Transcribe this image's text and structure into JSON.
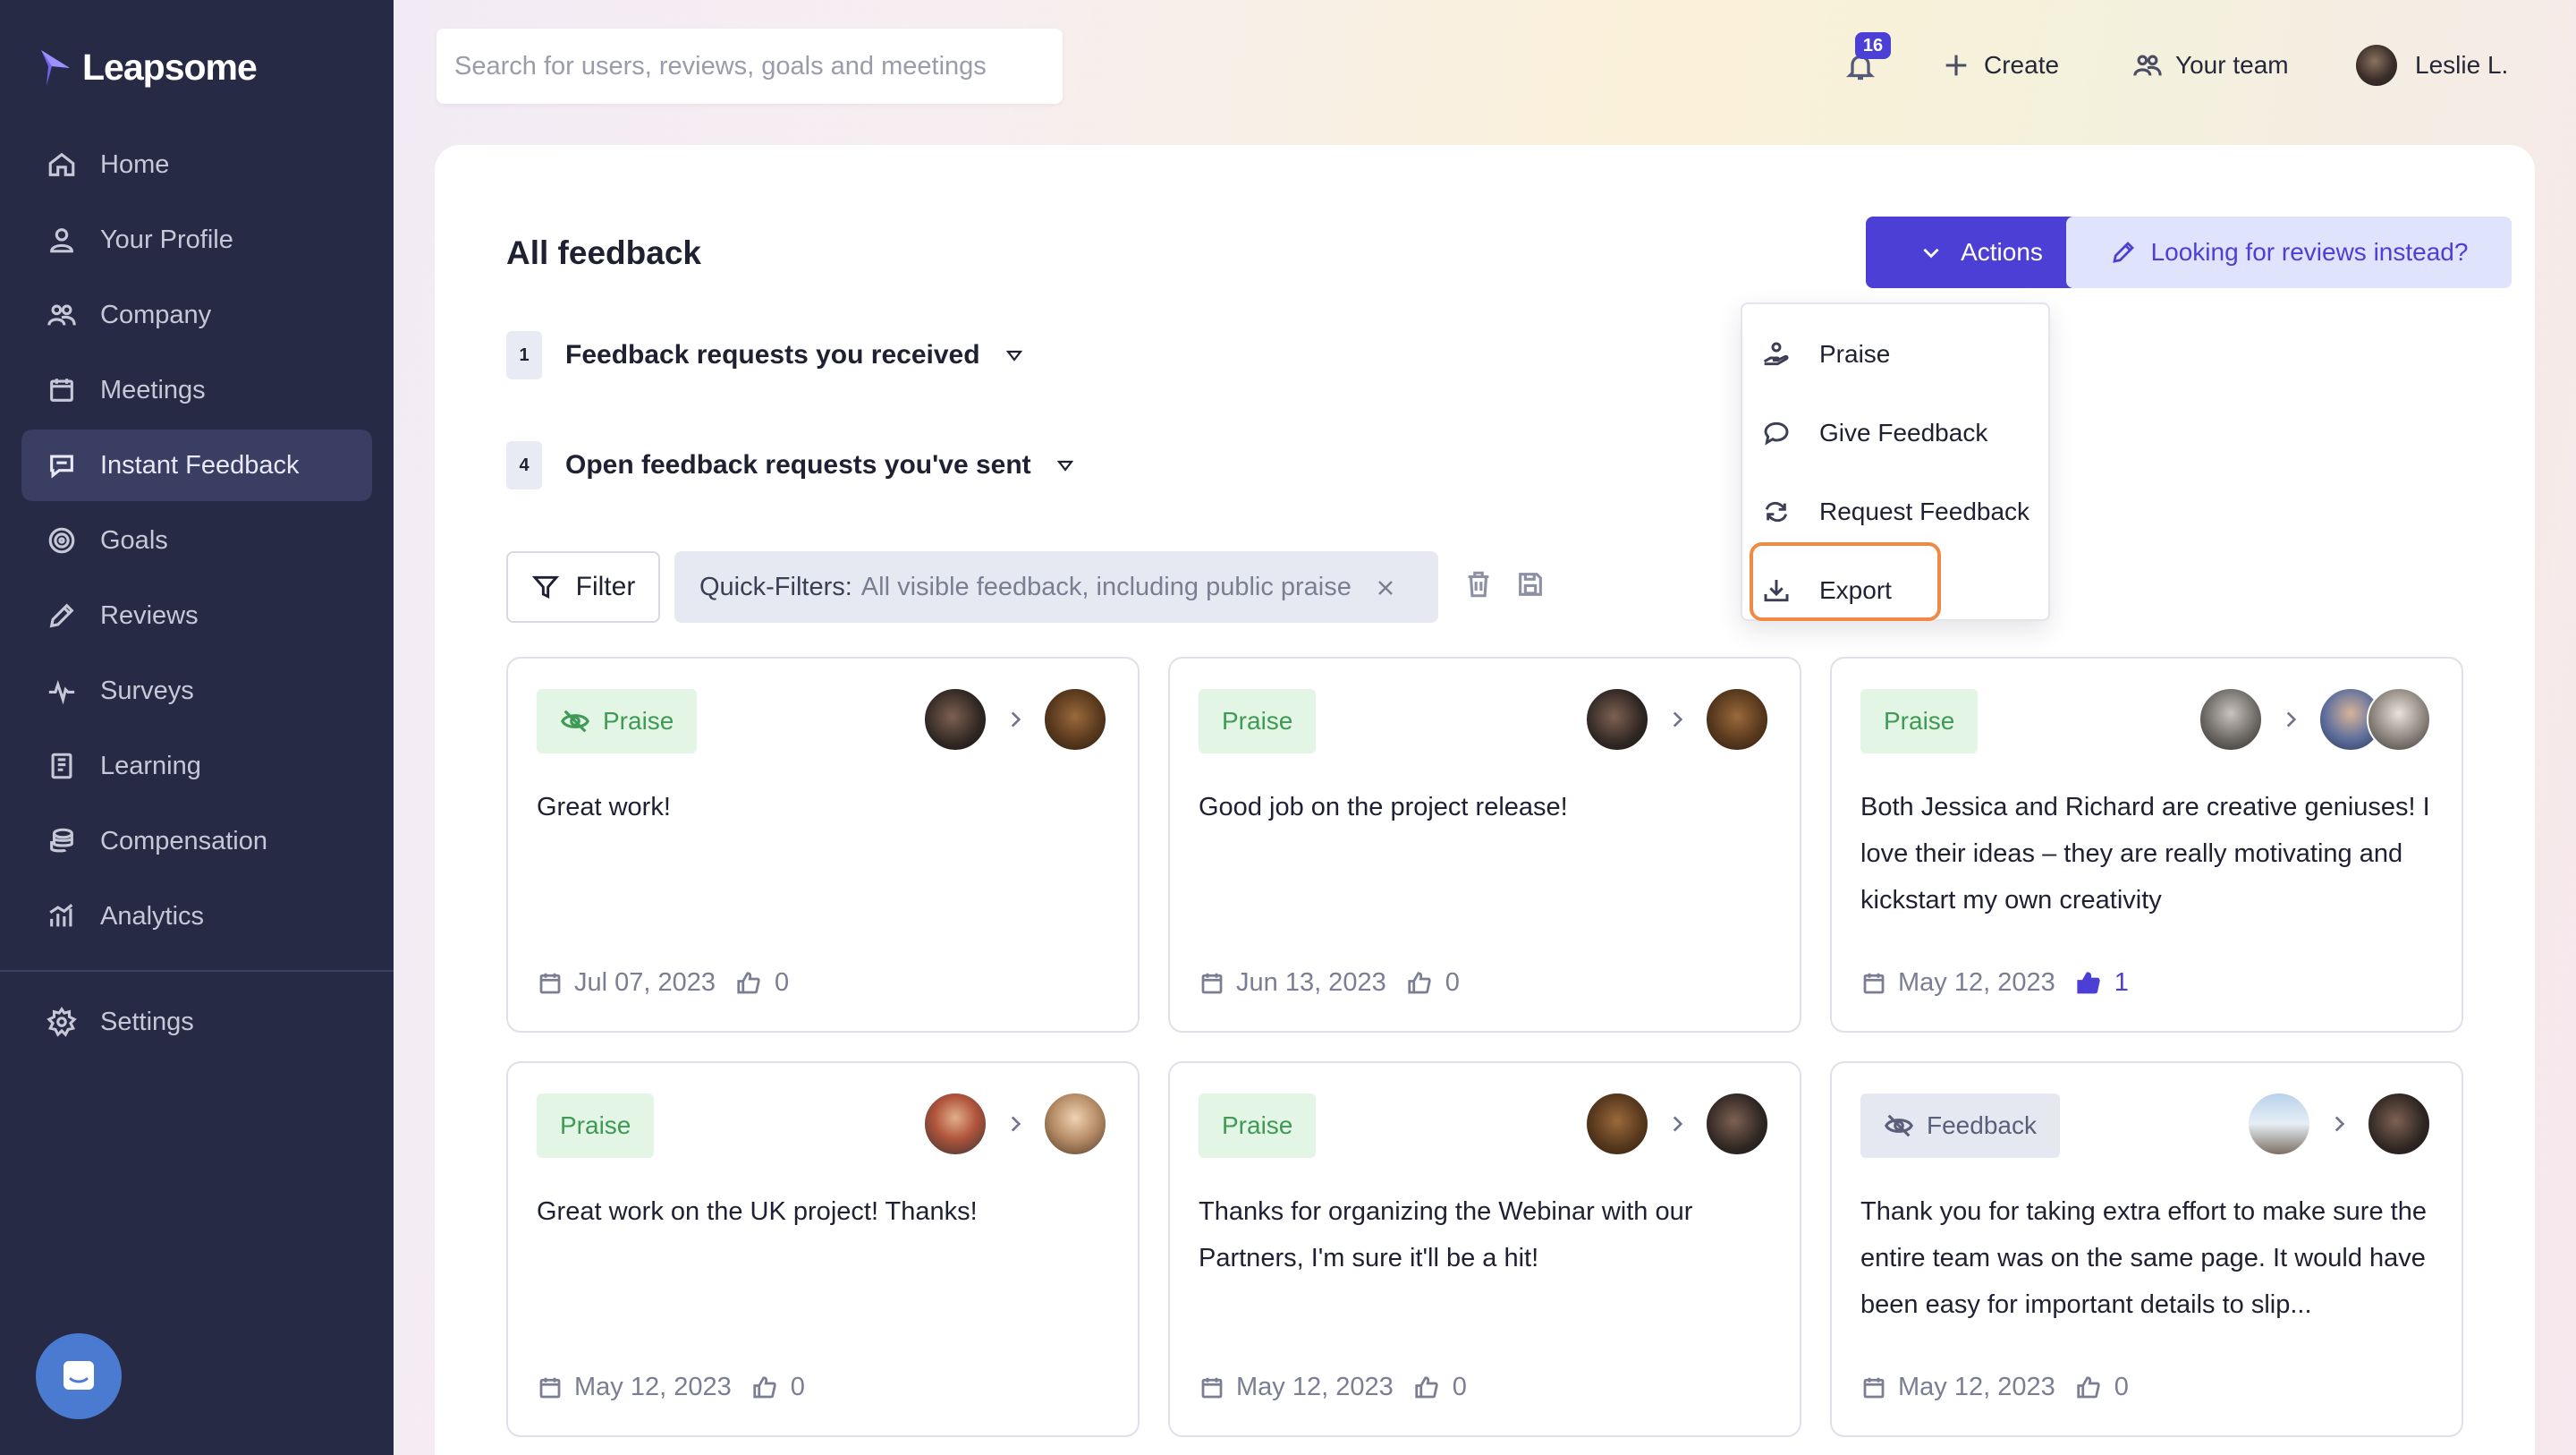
{
  "app": {
    "brand": "Leapsome"
  },
  "sidebar": {
    "items": [
      {
        "label": "Home",
        "icon": "home-icon"
      },
      {
        "label": "Your Profile",
        "icon": "user-icon"
      },
      {
        "label": "Company",
        "icon": "people-icon"
      },
      {
        "label": "Meetings",
        "icon": "calendar-icon"
      },
      {
        "label": "Instant Feedback",
        "icon": "chat-icon",
        "active": true
      },
      {
        "label": "Goals",
        "icon": "target-icon"
      },
      {
        "label": "Reviews",
        "icon": "pencil-icon"
      },
      {
        "label": "Surveys",
        "icon": "pulse-icon"
      },
      {
        "label": "Learning",
        "icon": "book-icon"
      },
      {
        "label": "Compensation",
        "icon": "coins-icon"
      },
      {
        "label": "Analytics",
        "icon": "chart-icon"
      }
    ],
    "settings": {
      "label": "Settings",
      "icon": "gear-icon"
    }
  },
  "topbar": {
    "search_placeholder": "Search for users, reviews, goals and meetings",
    "notifications_count": "16",
    "create_label": "Create",
    "your_team_label": "Your team",
    "user_name": "Leslie L."
  },
  "main": {
    "title": "All feedback",
    "actions_label": "Actions",
    "reviews_link_label": "Looking for reviews instead?",
    "requests_received": {
      "count": "1",
      "label": "Feedback requests you received"
    },
    "requests_sent": {
      "count": "4",
      "label": "Open feedback requests you've sent"
    },
    "filter_label": "Filter",
    "quick_filter": {
      "label": "Quick-Filters:",
      "value": "All visible feedback, including public praise"
    }
  },
  "actions_menu": {
    "items": [
      {
        "label": "Praise",
        "icon": "praise-hand-icon"
      },
      {
        "label": "Give Feedback",
        "icon": "speech-bubble-icon"
      },
      {
        "label": "Request Feedback",
        "icon": "refresh-arrows-icon"
      },
      {
        "label": "Export",
        "icon": "download-icon",
        "highlighted": true
      }
    ]
  },
  "feedback_cards": [
    {
      "type": "Praise",
      "private": true,
      "text": "Great work!",
      "date": "Jul 07, 2023",
      "likes": "0",
      "liked": false
    },
    {
      "type": "Praise",
      "private": false,
      "text": "Good job on the project release!",
      "date": "Jun 13, 2023",
      "likes": "0",
      "liked": false
    },
    {
      "type": "Praise",
      "private": false,
      "text": "Both Jessica and Richard are creative geniuses! I love their ideas – they are really motivating and kickstart my own creativity",
      "date": "May 12, 2023",
      "likes": "1",
      "liked": true
    },
    {
      "type": "Praise",
      "private": false,
      "text": "Great work on the UK project! Thanks!",
      "date": "May 12, 2023",
      "likes": "0",
      "liked": false
    },
    {
      "type": "Praise",
      "private": false,
      "text": "Thanks for organizing the Webinar with our Partners, I'm sure it'll be a hit!",
      "date": "May 12, 2023",
      "likes": "0",
      "liked": false
    },
    {
      "type": "Feedback",
      "private": true,
      "text": "Thank you for taking extra effort to make sure the entire team was on the same page. It would have been easy for important details to slip...",
      "date": "May 12, 2023",
      "likes": "0",
      "liked": false
    }
  ],
  "colors": {
    "sidebar_bg": "#272a44",
    "primary": "#4b3fd6",
    "praise_tag_bg": "#e3f5e5",
    "praise_tag_text": "#3f9a56",
    "highlight_ring": "#ee8a45"
  }
}
